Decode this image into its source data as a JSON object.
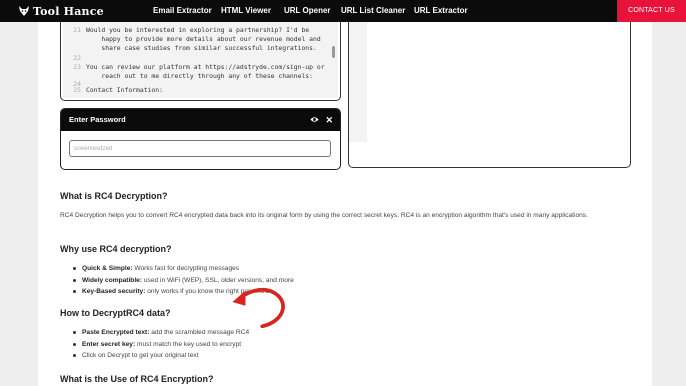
{
  "nav": {
    "brand": "Tool Hance",
    "links": [
      "Email Extractor",
      "HTML Viewer",
      "URL Opener",
      "URL List Cleaner",
      "URL Extractor"
    ],
    "contact": "CONTACT US"
  },
  "editor": {
    "lines": [
      {
        "n": "21",
        "t": "Would you be interested in exploring a partnership? I'd be"
      },
      {
        "n": "",
        "t": "    happy to provide more details about our revenue model and"
      },
      {
        "n": "",
        "t": "    share case studies from similar successful integrations."
      },
      {
        "n": "22",
        "t": ""
      },
      {
        "n": "23",
        "t": "You can review our platform at https://adstryde.com/sign-up or"
      },
      {
        "n": "",
        "t": "    reach out to me directly through any of these channels:"
      },
      {
        "n": "24",
        "t": ""
      },
      {
        "n": "25",
        "t": "Contact Information:"
      }
    ]
  },
  "password": {
    "title": "Enter Password",
    "value": "scwerxexdzed"
  },
  "sections": {
    "what_title": "What is RC4 Decryption?",
    "what_text": "RC4 Decryption helps you to convert RC4 encrypted data back into its original form by using the correct secret keys. RC4 is an encryption algorithm that's used in many applications.",
    "why_title": "Why use RC4 decryption?",
    "why_items": [
      {
        "bold": "Quick & Simple:",
        "text": " Works fast for decrypting messages"
      },
      {
        "bold": "Widely compatible:",
        "text": " used in WiFi (WEP), SSL, older versions, and more"
      },
      {
        "bold": "Key-Based security:",
        "text": " only works if you know the right password"
      }
    ],
    "how_title": "How to DecryptRC4 data?",
    "how_items": [
      {
        "bold": "Paste Encrypted text:",
        "text": " add the scrambled message RC4"
      },
      {
        "bold": "Enter secret key:",
        "text": " must match the key used to encrypt"
      },
      {
        "bold": "",
        "text": "Click on Decrypt to get your original text"
      }
    ],
    "use_title": "What is the Use of RC4 Encryption?"
  }
}
